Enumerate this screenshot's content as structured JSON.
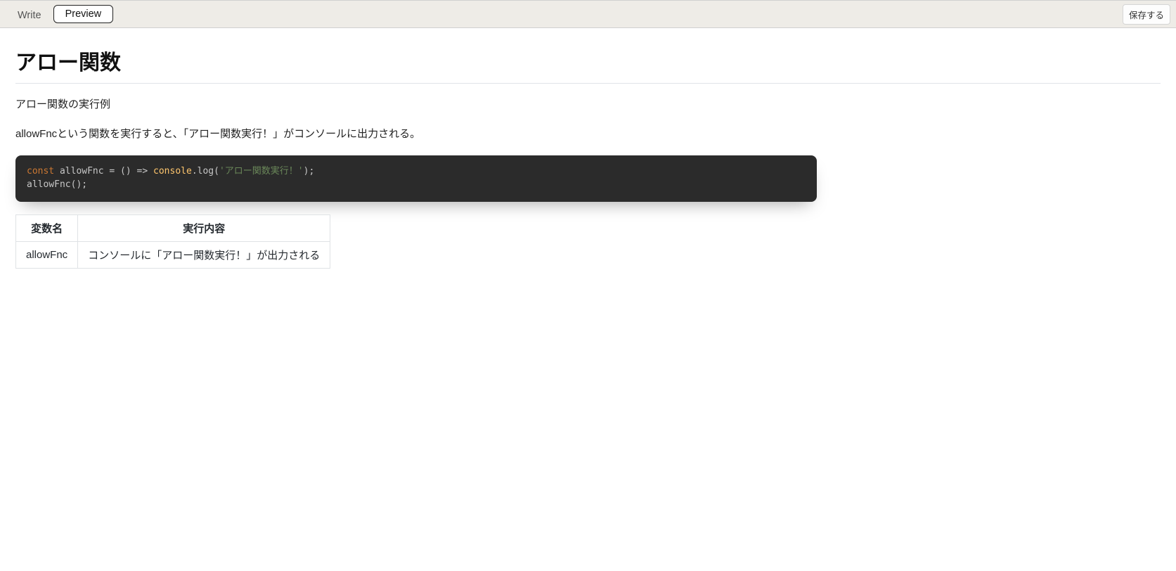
{
  "toolbar": {
    "tabs": [
      {
        "label": "Write",
        "active": false
      },
      {
        "label": "Preview",
        "active": true
      }
    ],
    "save_label": "保存する"
  },
  "article": {
    "title": "アロー関数",
    "paragraphs": [
      "アロー関数の実行例",
      "allowFncという関数を実行すると、「アロー関数実行！」がコンソールに出力される。"
    ],
    "code": {
      "line1": {
        "kw": "const",
        "sp1": " allowFnc = () => ",
        "fn": "console",
        "after_fn": ".log(",
        "str": "'アロー関数実行！'",
        "close": ");"
      },
      "line2": "allowFnc();"
    },
    "table": {
      "headers": [
        "変数名",
        "実行内容"
      ],
      "rows": [
        [
          "allowFnc",
          "コンソールに「アロー関数実行！」が出力される"
        ]
      ]
    }
  }
}
